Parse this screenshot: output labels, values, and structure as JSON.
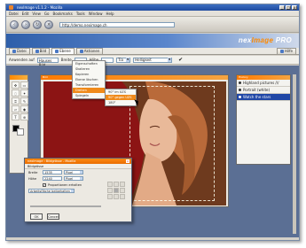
{
  "app": {
    "title": "nexImage v1.1.2 - Mozilla",
    "window_buttons": [
      "_",
      "□",
      "x"
    ]
  },
  "menubar": [
    "Datei",
    "Edit",
    "View",
    "Go",
    "Bookmarks",
    "Tools",
    "Window",
    "Help"
  ],
  "navbar": {
    "buttons": [
      "back",
      "forward",
      "reload",
      "stop"
    ],
    "address": "http://demo.neximage.ch"
  },
  "brand": {
    "prefix": "nex",
    "name": "Image",
    "suffix": "PRO"
  },
  "tabs": {
    "items": [
      "Datei",
      "Bild",
      "Ebene",
      "Aktionen"
    ],
    "help": "Hilfe"
  },
  "optbar": {
    "label": "Anwenden auf",
    "apply_value": "Hauses Bild",
    "breite_label": "Breite",
    "hohe_label": "Höhe",
    "mode_value": "Helligkeit",
    "size_value": "Tia"
  },
  "image_window": {
    "title": "Bild"
  },
  "context_menu": {
    "items": [
      "Eigenschaften",
      "Skalieren",
      "Kopieren",
      "Ebene löschen",
      "Transformieren",
      "Drehen",
      "Spiegeln"
    ],
    "highlight": "Drehen"
  },
  "submenu": {
    "items": [
      "90° im UZS",
      "90° gegen UZS",
      "180°"
    ],
    "highlight": "90° gegen UZS"
  },
  "history": {
    "title": "History",
    "items": [
      "Highland pictures ///",
      "Portrait (white)",
      "Watch the stars"
    ],
    "selected": "Watch the stars"
  },
  "dialog": {
    "title": "nexImage : Bildgrösse - Mozilla",
    "subtitle": "Bildgrösse",
    "breite_label": "Breite",
    "breite_value": "1535",
    "breite_unit": "Pixel",
    "hohe_label": "Höhe",
    "hohe_value": "2240",
    "hohe_unit": "Pixel",
    "keep_ratio": "Proportionen erhalten",
    "resample": "Arbeitsfläche beibehalten",
    "ok": "OK",
    "cancel": "Cancel"
  }
}
